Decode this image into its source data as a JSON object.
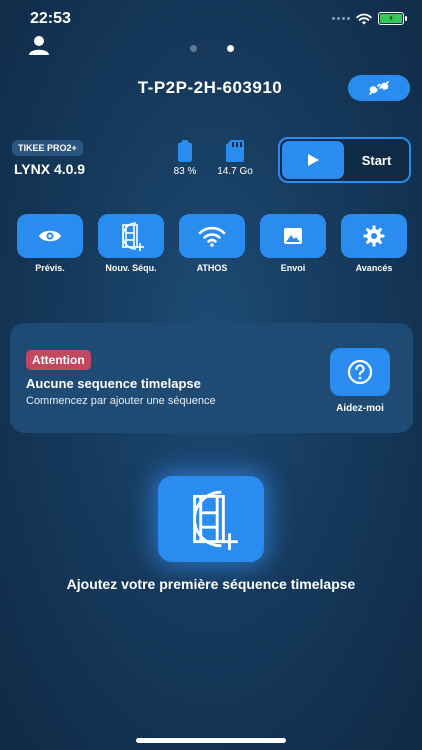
{
  "status_bar": {
    "time": "22:53",
    "battery_icon": "charging-battery-icon"
  },
  "header": {
    "device_name": "T-P2P-2H-603910",
    "connect_icon": "plug-connected-icon"
  },
  "device": {
    "model_badge": "TIKEE PRO2+",
    "firmware": "LYNX 4.0.9",
    "battery_value": "83 %",
    "storage_value": "14.7 Go"
  },
  "start": {
    "label": "Start"
  },
  "actions": [
    {
      "label": "Prévis.",
      "icon": "eye-icon"
    },
    {
      "label": "Nouv. Séqu.",
      "icon": "film-add-icon"
    },
    {
      "label": "ATHOS",
      "icon": "wifi-icon"
    },
    {
      "label": "Envoi",
      "icon": "image-icon"
    },
    {
      "label": "Avancés",
      "icon": "gear-icon"
    }
  ],
  "alert": {
    "badge": "Attention",
    "title": "Aucune sequence timelapse",
    "subtitle": "Commencez par ajouter une séquence",
    "help_label": "Aidez-moi"
  },
  "empty_state": {
    "text": "Ajoutez votre première séquence timelapse"
  },
  "colors": {
    "accent": "#2b8cf0",
    "badge_attention": "#c0485f",
    "background": "#163a5d"
  }
}
